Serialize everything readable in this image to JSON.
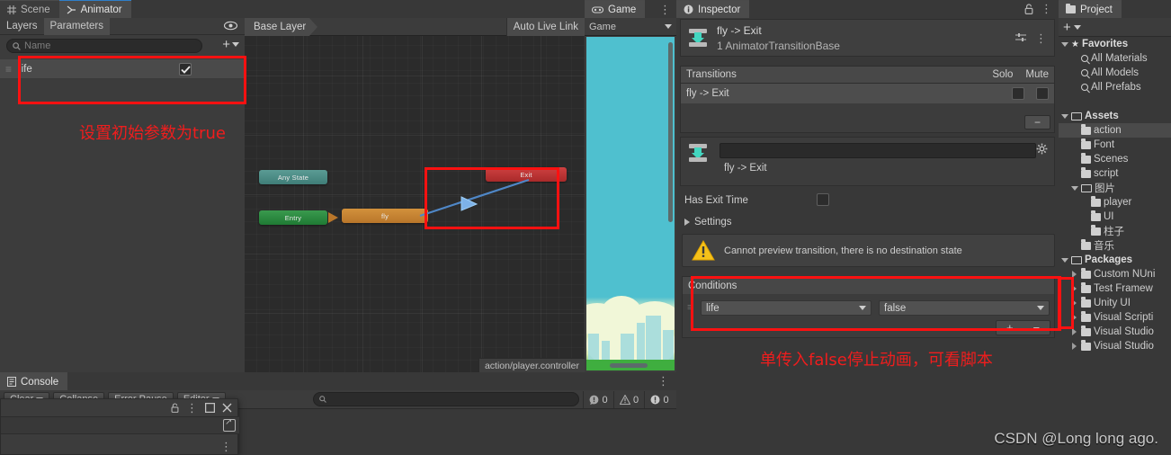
{
  "animator": {
    "tabs": [
      {
        "label": "Scene",
        "icon": "grid-icon",
        "active": false
      },
      {
        "label": "Animator",
        "icon": "animator-icon",
        "active": true
      }
    ],
    "subtabs": [
      {
        "label": "Layers",
        "selected": false
      },
      {
        "label": "Parameters",
        "selected": true
      }
    ],
    "eye_icon": "eye-icon",
    "search_placeholder": "Name",
    "add_button": "+",
    "parameter": {
      "name": "life",
      "checked": true
    },
    "graph": {
      "breadcrumb": "Base Layer",
      "auto_live_link": "Auto Live Link",
      "nodes": [
        {
          "name": "Any State",
          "type": "any-state"
        },
        {
          "name": "Entry",
          "type": "entry"
        },
        {
          "name": "fly",
          "type": "state"
        },
        {
          "name": "Exit",
          "type": "exit"
        }
      ],
      "status": "action/player.controller"
    }
  },
  "game": {
    "tab_label": "Game",
    "tab_icon": "gamepad-icon",
    "view_dropdown": "Game",
    "kebab": "⋮"
  },
  "inspector": {
    "tab_label": "Inspector",
    "tab_icon": "info-icon",
    "lock_icon": "lock-icon",
    "kebab": "⋮",
    "object": {
      "title": "fly -> Exit",
      "subtitle": "1 AnimatorTransitionBase",
      "icon": "transition-icon",
      "preset_icon": "preset-icon"
    },
    "transitions": {
      "header": "Transitions",
      "solo_label": "Solo",
      "mute_label": "Mute",
      "rows": [
        {
          "label": "fly -> Exit",
          "solo": false,
          "mute": false
        }
      ],
      "remove_button": "−"
    },
    "name_section": {
      "field_value": "",
      "label": "fly -> Exit",
      "gear_icon": "gear-icon",
      "icon": "transition-icon"
    },
    "has_exit_time": {
      "label": "Has Exit Time",
      "checked": false
    },
    "settings": {
      "label": "Settings",
      "expanded": false
    },
    "warning": {
      "icon": "warning-icon",
      "text": "Cannot preview transition, there is no destination state"
    },
    "conditions": {
      "header": "Conditions",
      "rows": [
        {
          "parameter": "life",
          "value": "false"
        }
      ],
      "add_button": "+",
      "remove_button": "−"
    }
  },
  "project": {
    "tab_label": "Project",
    "tab_icon": "folder-icon",
    "add_button": "+",
    "tree": [
      {
        "label": "Favorites",
        "depth": 0,
        "twisty": "down",
        "icon": "star-icon",
        "bold": true,
        "selected": false
      },
      {
        "label": "All Materials",
        "depth": 1,
        "twisty": "none",
        "icon": "search-icon",
        "bold": false,
        "selected": false
      },
      {
        "label": "All Models",
        "depth": 1,
        "twisty": "none",
        "icon": "search-icon",
        "bold": false,
        "selected": false
      },
      {
        "label": "All Prefabs",
        "depth": 1,
        "twisty": "none",
        "icon": "search-icon",
        "bold": false,
        "selected": false
      },
      {
        "label": "",
        "depth": 0,
        "twisty": "none",
        "icon": "none",
        "bold": false,
        "selected": false
      },
      {
        "label": "Assets",
        "depth": 0,
        "twisty": "down",
        "icon": "folder-open-icon",
        "bold": true,
        "selected": false
      },
      {
        "label": "action",
        "depth": 1,
        "twisty": "none",
        "icon": "folder-icon",
        "bold": false,
        "selected": true
      },
      {
        "label": "Font",
        "depth": 1,
        "twisty": "none",
        "icon": "folder-icon",
        "bold": false,
        "selected": false
      },
      {
        "label": "Scenes",
        "depth": 1,
        "twisty": "none",
        "icon": "folder-icon",
        "bold": false,
        "selected": false
      },
      {
        "label": "script",
        "depth": 1,
        "twisty": "none",
        "icon": "folder-icon",
        "bold": false,
        "selected": false
      },
      {
        "label": "图片",
        "depth": 1,
        "twisty": "down",
        "icon": "folder-open-icon",
        "bold": false,
        "selected": false
      },
      {
        "label": "player",
        "depth": 2,
        "twisty": "none",
        "icon": "folder-icon",
        "bold": false,
        "selected": false
      },
      {
        "label": "UI",
        "depth": 2,
        "twisty": "none",
        "icon": "folder-icon",
        "bold": false,
        "selected": false
      },
      {
        "label": "柱子",
        "depth": 2,
        "twisty": "none",
        "icon": "folder-icon",
        "bold": false,
        "selected": false
      },
      {
        "label": "音乐",
        "depth": 1,
        "twisty": "none",
        "icon": "folder-icon",
        "bold": false,
        "selected": false
      },
      {
        "label": "Packages",
        "depth": 0,
        "twisty": "down",
        "icon": "folder-open-icon",
        "bold": true,
        "selected": false
      },
      {
        "label": "Custom NUni",
        "depth": 1,
        "twisty": "right",
        "icon": "folder-icon",
        "bold": false,
        "selected": false
      },
      {
        "label": "Test Framew",
        "depth": 1,
        "twisty": "right",
        "icon": "folder-icon",
        "bold": false,
        "selected": false
      },
      {
        "label": "Unity UI",
        "depth": 1,
        "twisty": "right",
        "icon": "folder-icon",
        "bold": false,
        "selected": false
      },
      {
        "label": "Visual Scripti",
        "depth": 1,
        "twisty": "right",
        "icon": "folder-icon",
        "bold": false,
        "selected": false
      },
      {
        "label": "Visual Studio",
        "depth": 1,
        "twisty": "right",
        "icon": "folder-icon",
        "bold": false,
        "selected": false
      },
      {
        "label": "Visual Studio",
        "depth": 1,
        "twisty": "right",
        "icon": "folder-icon",
        "bold": false,
        "selected": false
      }
    ]
  },
  "console": {
    "tab_label": "Console",
    "tab_icon": "console-icon",
    "kebab": "⋮",
    "buttons": [
      {
        "label": "Clear",
        "has_caret": true
      },
      {
        "label": "Collapse",
        "has_caret": false
      },
      {
        "label": "Error Pause",
        "has_caret": false
      },
      {
        "label": "Editor",
        "has_caret": true
      }
    ],
    "search_placeholder": "",
    "counters": [
      {
        "icon": "log-icon",
        "count": "0"
      },
      {
        "icon": "warning-icon",
        "count": "0"
      },
      {
        "icon": "error-icon",
        "count": "0"
      }
    ]
  },
  "popup": {
    "lock_icon": "lock-icon",
    "kebab": "⋮",
    "maximize_icon": "maximize-icon",
    "close_icon": "close-icon",
    "open_icon": "open-external-icon",
    "row_kebab": "⋮"
  },
  "annotations": {
    "params_note": "设置初始参数为true",
    "conditions_note": "单传入false停止动画，可看脚本",
    "watermark": "CSDN @Long long ago.",
    "color": "#f01d1d"
  }
}
